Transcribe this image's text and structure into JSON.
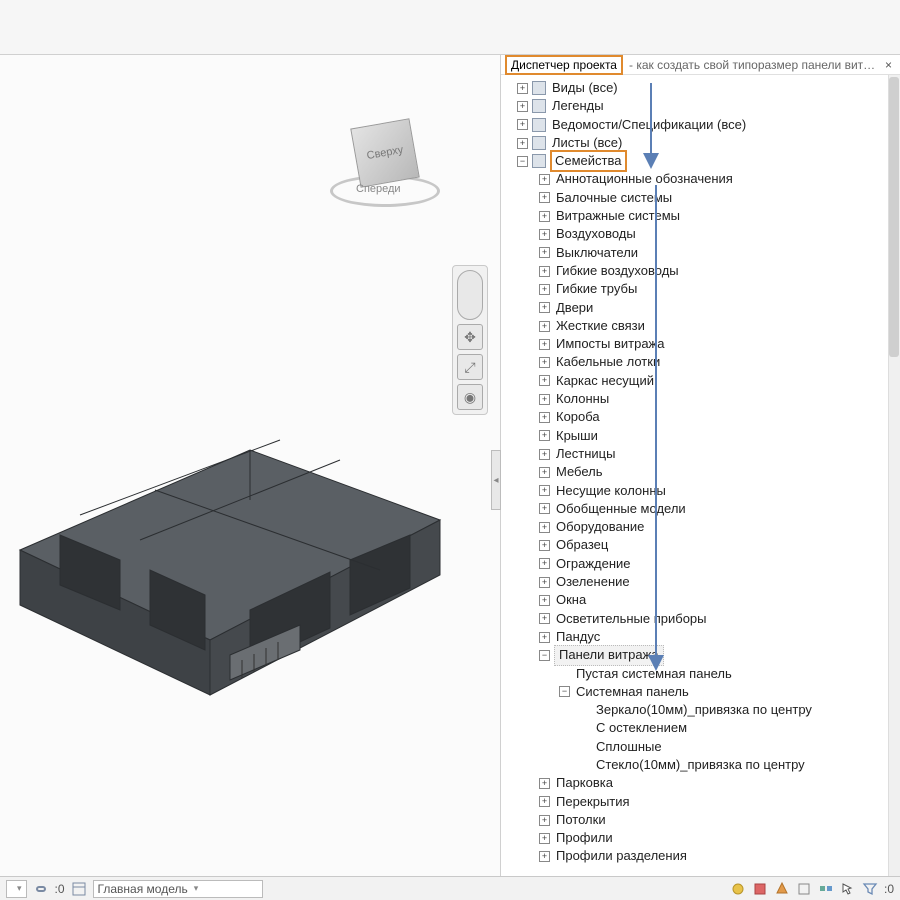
{
  "panel": {
    "title": "Диспетчер проекта",
    "subtitle": "- как создать свой типоразмер панели витра..."
  },
  "navcube": {
    "top": "Сверху",
    "front": "Спереди"
  },
  "tree_top": [
    {
      "label": "Виды (все)",
      "icon": true
    },
    {
      "label": "Легенды",
      "icon": true
    },
    {
      "label": "Ведомости/Спецификации (все)",
      "icon": true
    },
    {
      "label": "Листы (все)",
      "icon": true
    }
  ],
  "families_label": "Семейства",
  "families_children": [
    "Аннотационные обозначения",
    "Балочные системы",
    "Витражные системы",
    "Воздуховоды",
    "Выключатели",
    "Гибкие воздуховоды",
    "Гибкие трубы",
    "Двери",
    "Жесткие связи",
    "Импосты витража",
    "Кабельные лотки",
    "Каркас несущий",
    "Колонны",
    "Короба",
    "Крыши",
    "Лестницы",
    "Мебель",
    "Несущие колонны",
    "Обобщенные модели",
    "Оборудование",
    "Образец",
    "Ограждение",
    "Озеленение",
    "Окна",
    "Осветительные приборы",
    "Пандус"
  ],
  "vitr_panel_label": "Панели витража",
  "vitr_children": [
    {
      "label": "Пустая системная панель",
      "expand": ""
    },
    {
      "label": "Системная панель",
      "expand": "−"
    }
  ],
  "vitr_sys_children": [
    "Зеркало(10мм)_привязка по центру",
    "С остеклением",
    "Сплошные",
    "Стекло(10мм)_привязка по центру"
  ],
  "tree_bottom": [
    "Парковка",
    "Перекрытия",
    "Потолки",
    "Профили",
    "Профили разделения"
  ],
  "statusbar": {
    "zero": ":0",
    "model_label": "Главная модель",
    "filter_zero": ":0"
  }
}
